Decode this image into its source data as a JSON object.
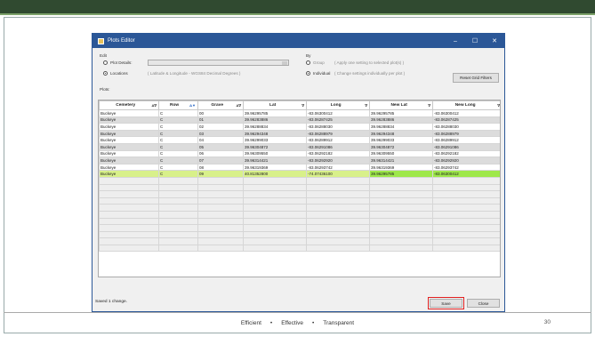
{
  "window": {
    "title": "Plots Editor"
  },
  "edit": {
    "label": "Edit",
    "plot_details": "Plot Details:",
    "locations": "Locations",
    "locations_hint": "( Latitude & Longitude - WGS84 Decimal Degrees )"
  },
  "by": {
    "label": "By",
    "group": "Group",
    "group_hint": "( Apply one setting to selected plot(s) )",
    "individual": "Individual",
    "individual_hint": "( Change settings individually per plot )"
  },
  "reset_label": "Reset Grid Filters",
  "plots_label": "Plots:",
  "columns": [
    "Cemetery",
    "Row",
    "Grave",
    "Lat",
    "Long",
    "New Lat",
    "New Long"
  ],
  "rows": [
    [
      "Buckeye",
      "C",
      "00",
      "39.96295785",
      "-83.06300412",
      "39.96295785",
      "-83.06300412"
    ],
    [
      "Buckeye",
      "C",
      "01",
      "39.96283886",
      "-83.06287425",
      "39.96283886",
      "-83.06287425"
    ],
    [
      "Buckeye",
      "C",
      "02",
      "39.96288834",
      "-83.06288030",
      "39.96288834",
      "-83.06288030"
    ],
    [
      "Buckeye",
      "C",
      "03",
      "39.96294348",
      "-83.06288979",
      "39.96294348",
      "-83.06288979"
    ],
    [
      "Buckeye",
      "C",
      "04",
      "39.96299033",
      "-83.06289912",
      "39.96299033",
      "-83.06289912"
    ],
    [
      "Buckeye",
      "C",
      "05",
      "39.96304872",
      "-83.06291086",
      "39.96304872",
      "-83.06291086"
    ],
    [
      "Buckeye",
      "C",
      "06",
      "39.96309550",
      "-83.06292182",
      "39.96309550",
      "-83.06292182"
    ],
    [
      "Buckeye",
      "C",
      "07",
      "39.96314421",
      "-83.06292920",
      "39.96314421",
      "-83.06292920"
    ],
    [
      "Buckeye",
      "C",
      "08",
      "39.96319369",
      "-83.06293742",
      "39.96319369",
      "-83.06293742"
    ],
    [
      "Buckeye",
      "C",
      "09",
      "40.81352800",
      "-74.07436100",
      "39.96295785",
      "-83.06300412"
    ]
  ],
  "save_label": "Save",
  "close_label": "Close",
  "status": "Saved 1 change.",
  "footer": {
    "items": [
      "Efficient",
      "•",
      "Effective",
      "•",
      "Transparent"
    ],
    "page": "30"
  },
  "colors": {
    "titlebar": "#2b5797",
    "changed_row": "#d8f08a",
    "changed_cell": "#9ee84a",
    "save_highlight": "#e02020"
  }
}
